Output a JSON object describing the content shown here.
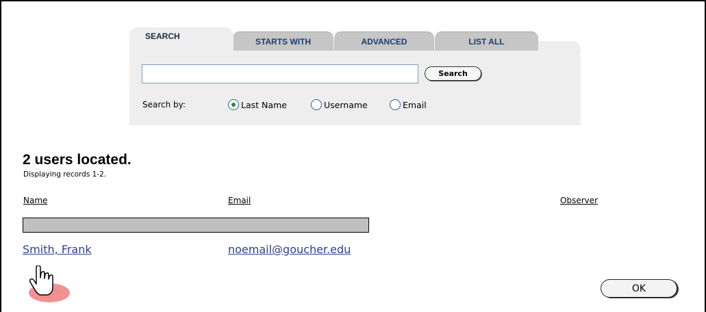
{
  "tabs": [
    {
      "label": "SEARCH",
      "active": true
    },
    {
      "label": "STARTS WITH",
      "active": false
    },
    {
      "label": "ADVANCED",
      "active": false
    },
    {
      "label": "LIST ALL",
      "active": false
    }
  ],
  "search": {
    "input_value": "",
    "button_label": "Search",
    "search_by_label": "Search by:",
    "options": [
      {
        "label": "Last Name",
        "selected": true
      },
      {
        "label": "Username",
        "selected": false
      },
      {
        "label": "Email",
        "selected": false
      }
    ]
  },
  "results": {
    "headline": "2 users located.",
    "subline": "Displaying records 1-2.",
    "columns": [
      "Name",
      "Email",
      "Observer"
    ],
    "rows": [
      {
        "name": "",
        "email": "",
        "redacted": true
      },
      {
        "name": "Smith, Frank",
        "email": "noemail@goucher.edu",
        "redacted": false
      }
    ]
  },
  "ok_button": {
    "label": "OK"
  },
  "colors": {
    "tab_text": "#1b3f6e",
    "link": "#2b3f8f",
    "panel": "#eeeeee",
    "radio_selected": "#2d8f2d"
  }
}
